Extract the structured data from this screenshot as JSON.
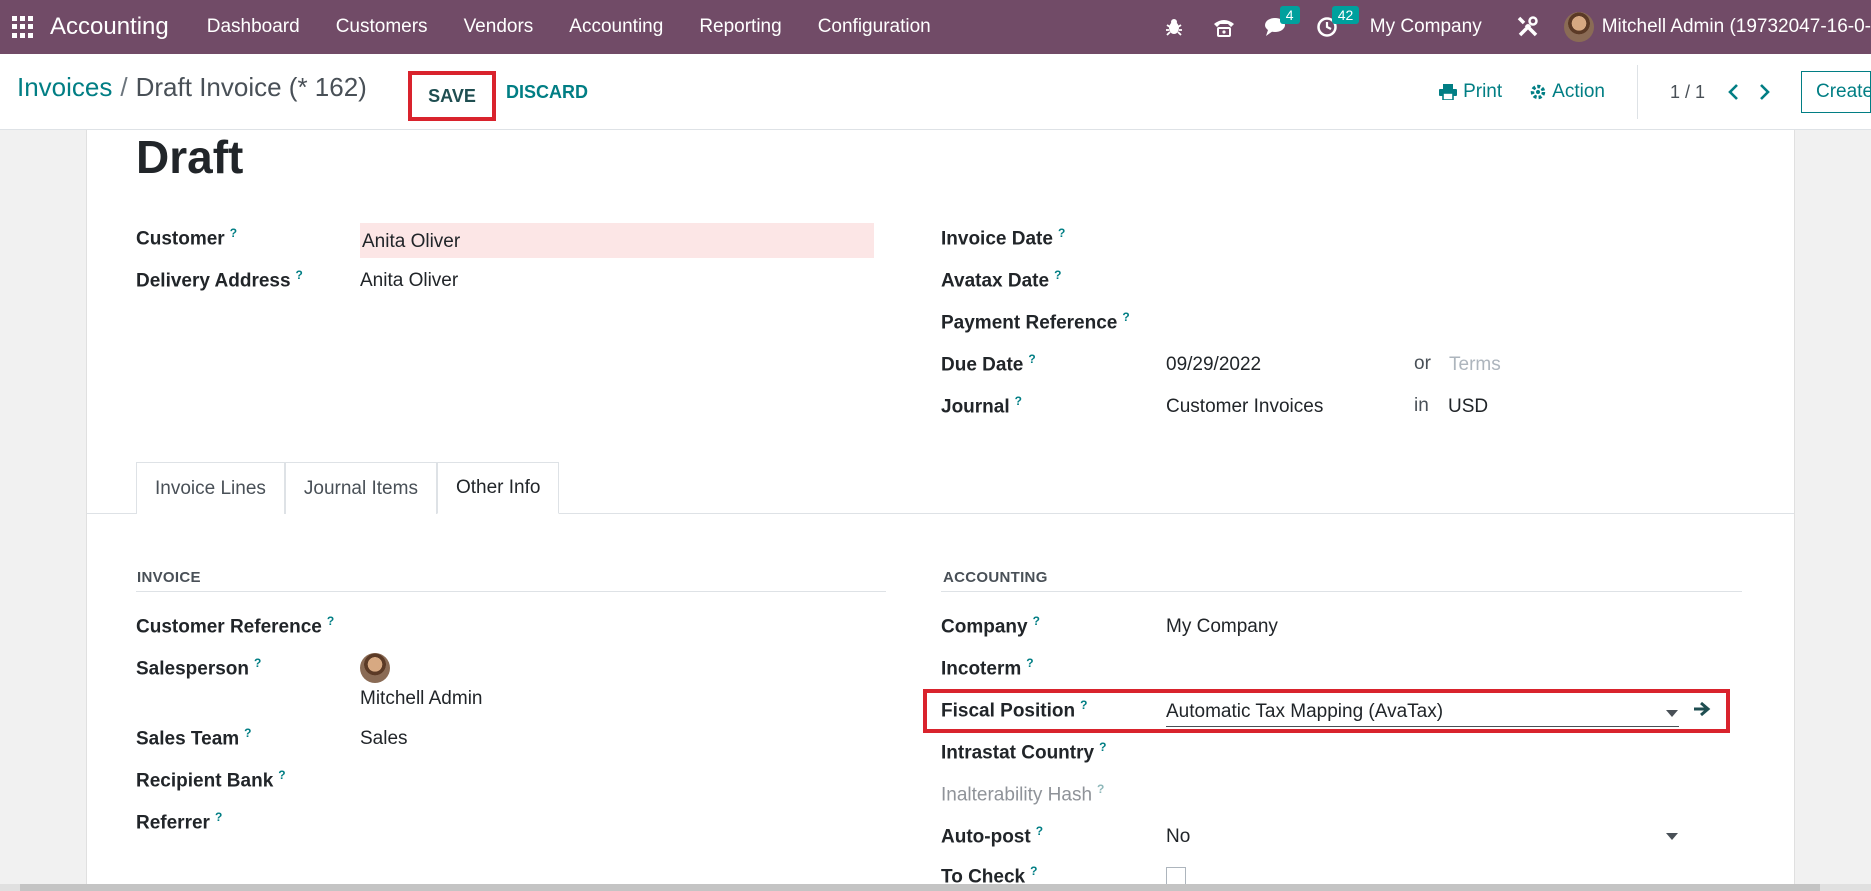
{
  "navbar": {
    "app_name": "Accounting",
    "menu": [
      "Dashboard",
      "Customers",
      "Vendors",
      "Accounting",
      "Reporting",
      "Configuration"
    ],
    "messages_count": "4",
    "activities_count": "42",
    "company": "My Company",
    "user": "Mitchell Admin (19732047-16-0-"
  },
  "control_panel": {
    "breadcrumb_parent": "Invoices",
    "breadcrumb_separator": "/",
    "breadcrumb_current": "Draft Invoice (* 162)",
    "save_label": "SAVE",
    "discard_label": "DISCARD",
    "print_label": "Print",
    "action_label": "Action",
    "pager": "1 / 1",
    "create_label": "Create"
  },
  "form": {
    "status": "Draft",
    "customer_label": "Customer",
    "customer_value": "Anita Oliver",
    "delivery_label": "Delivery Address",
    "delivery_value": "Anita Oliver",
    "invoice_date_label": "Invoice Date",
    "avatax_date_label": "Avatax Date",
    "payment_ref_label": "Payment Reference",
    "due_date_label": "Due Date",
    "due_date_value": "09/29/2022",
    "or_label": "or",
    "terms_placeholder": "Terms",
    "journal_label": "Journal",
    "journal_value": "Customer Invoices",
    "in_label": "in",
    "currency_value": "USD",
    "help_mark": "?"
  },
  "tabs": [
    "Invoice Lines",
    "Journal Items",
    "Other Info"
  ],
  "invoice_section": {
    "title": "INVOICE",
    "customer_reference_label": "Customer Reference",
    "salesperson_label": "Salesperson",
    "salesperson_value": "Mitchell Admin",
    "sales_team_label": "Sales Team",
    "sales_team_value": "Sales",
    "recipient_bank_label": "Recipient Bank",
    "referrer_label": "Referrer"
  },
  "accounting_section": {
    "title": "ACCOUNTING",
    "company_label": "Company",
    "company_value": "My Company",
    "incoterm_label": "Incoterm",
    "fiscal_position_label": "Fiscal Position",
    "fiscal_position_value": "Automatic Tax Mapping (AvaTax)",
    "intrastat_label": "Intrastat Country",
    "inalterability_label": "Inalterability Hash",
    "autopost_label": "Auto-post",
    "autopost_value": "No",
    "to_check_label": "To Check"
  },
  "colors": {
    "navbar": "#714b67",
    "accent": "#017e84",
    "highlight": "#d9232d",
    "required_field": "#fce6e6"
  }
}
